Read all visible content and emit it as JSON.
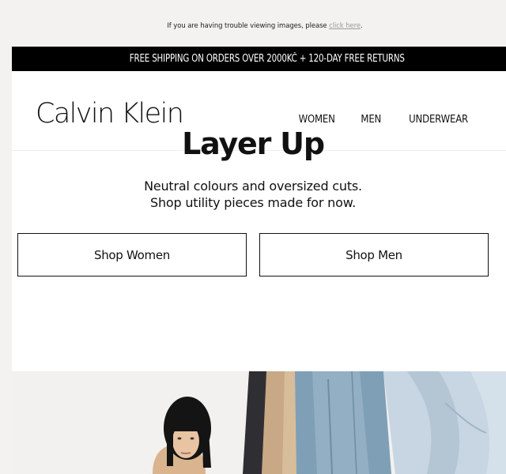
{
  "preheader": {
    "text": "If you are having trouble viewing images, please ",
    "link": "click here",
    "suffix": "."
  },
  "promo": {
    "text": "FREE SHIPPING ON ORDERS OVER 2000KČ + 120-DAY FREE RETURNS"
  },
  "brand": {
    "logo": "Calvin Klein"
  },
  "nav": {
    "items": [
      "WOMEN",
      "MEN",
      "UNDERWEAR"
    ]
  },
  "hero": {
    "title": "Layer Up",
    "subtitle_line1": "Neutral colours and oversized cuts.",
    "subtitle_line2": "Shop utility pieces made for now.",
    "cta_women": "Shop Women",
    "cta_men": "Shop Men"
  },
  "colors": {
    "background": "#f3f2f0",
    "promo_bar": "#000000",
    "text": "#111111",
    "link": "#9a9a9a"
  }
}
